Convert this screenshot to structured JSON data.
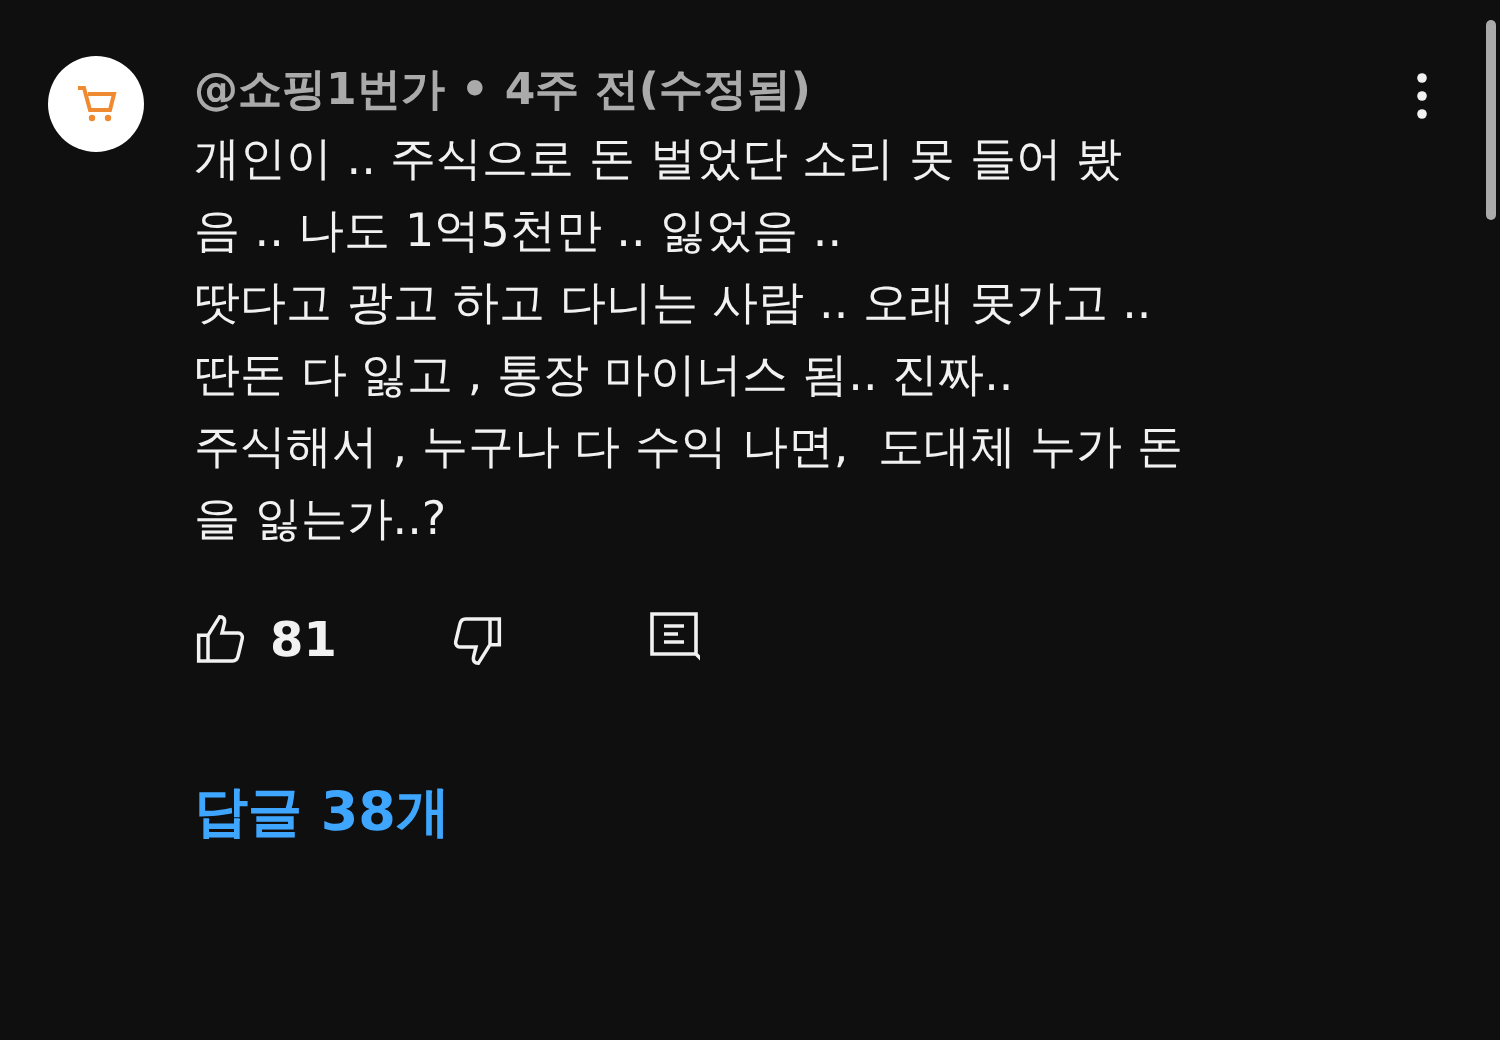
{
  "comment": {
    "author": "@쇼핑1번가",
    "separator": "•",
    "time": "4주 전(수정됨)",
    "lines": [
      "개인이 .. 주식으로 돈 벌었단 소리 못 들어 봤",
      "음 .. 나도 1억5천만 .. 잃었음 ..",
      "땃다고 광고 하고 다니는 사람 .. 오래 못가고 ..",
      "딴돈 다 잃고 , 통장 마이너스 됨.. 진짜..",
      "주식해서 , 누구나 다 수익 나면,  도대체 누가 돈",
      "을 잃는가..?"
    ],
    "likes": "81",
    "replies": "답글 38개"
  }
}
